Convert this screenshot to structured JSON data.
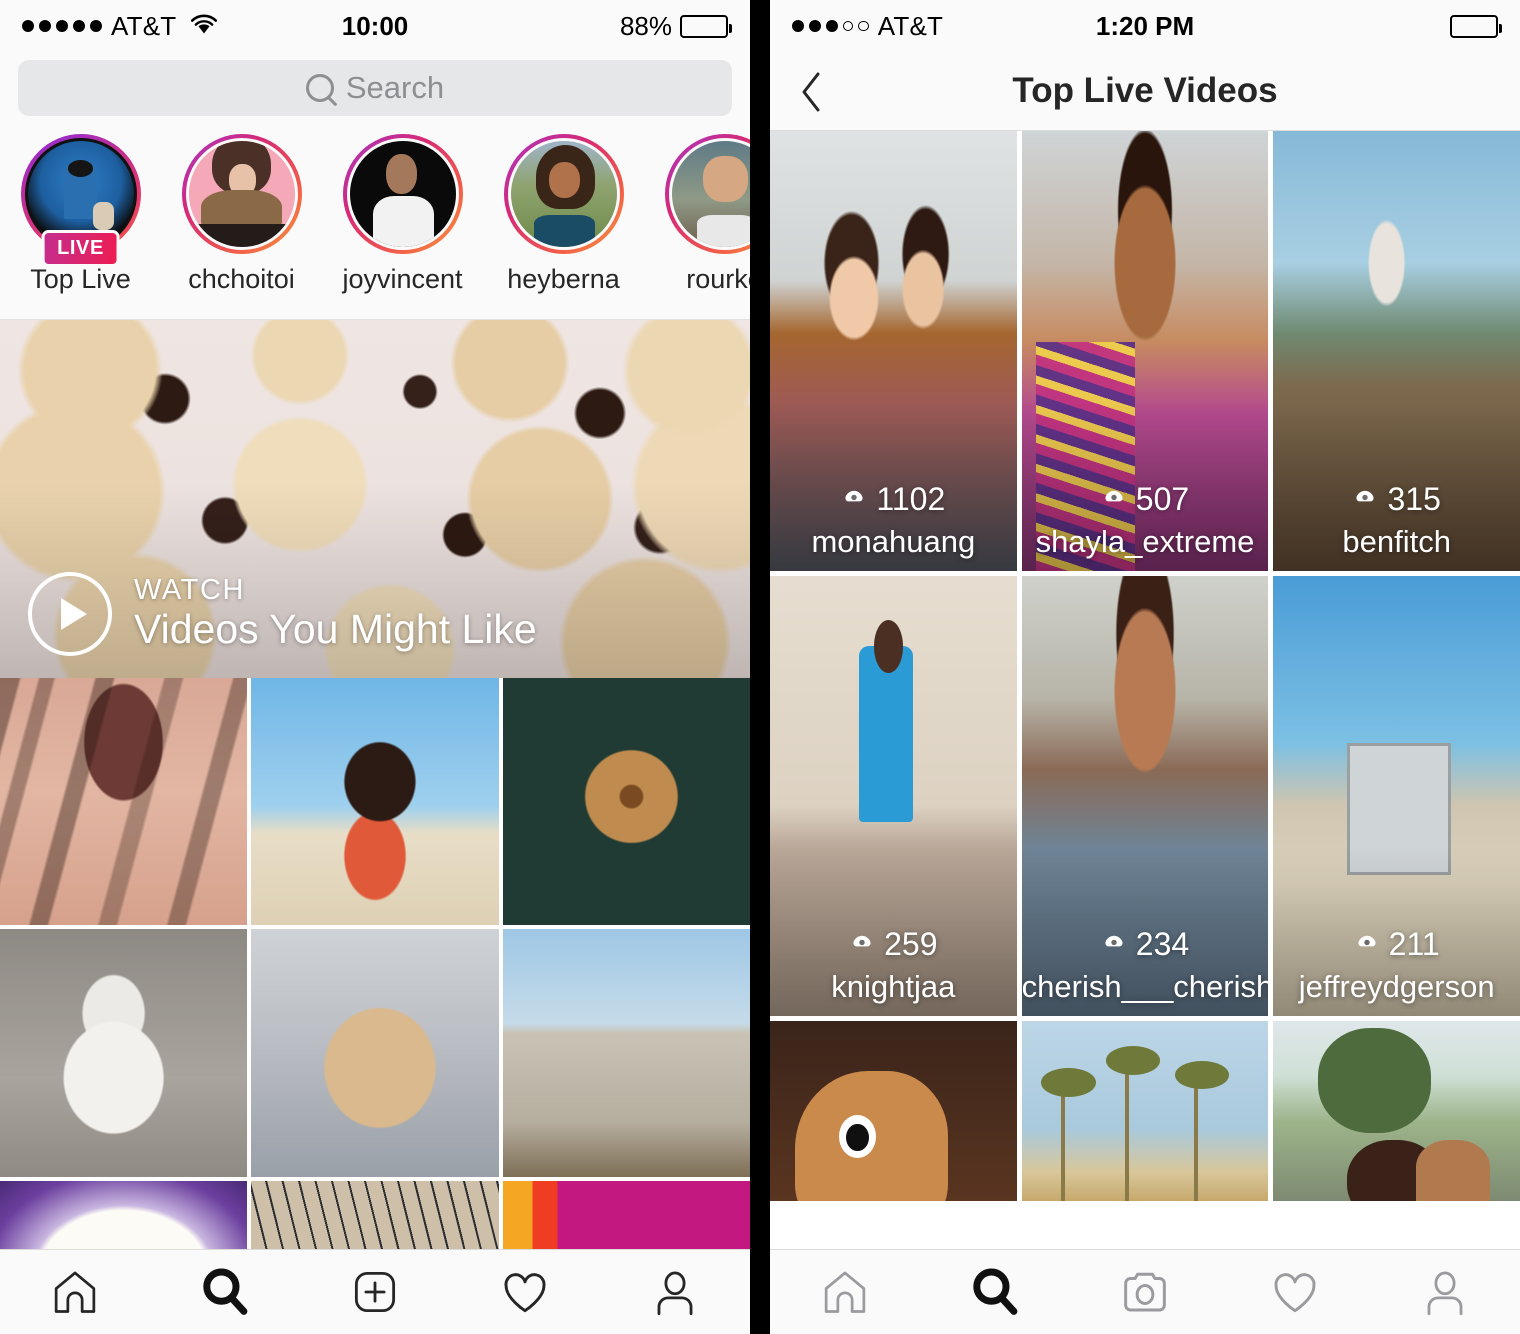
{
  "left": {
    "status": {
      "carrier": "AT&T",
      "time": "10:00",
      "battery": "88%",
      "signal_dots": 5,
      "signal_filled": 5,
      "wifi": true
    },
    "search": {
      "placeholder": "Search",
      "icon": "search-icon"
    },
    "stories": [
      {
        "username": "Top Live",
        "badge": "LIVE",
        "is_live": true
      },
      {
        "username": "chchoitoi",
        "badge": null,
        "is_live": false
      },
      {
        "username": "joyvincent",
        "badge": null,
        "is_live": false
      },
      {
        "username": "heyberna",
        "badge": null,
        "is_live": false
      },
      {
        "username": "rourke",
        "badge": null,
        "is_live": false
      }
    ],
    "banner": {
      "eyebrow": "WATCH",
      "title": "Videos You Might Like",
      "icon": "play-icon"
    },
    "grid_rows": [
      [
        "house-shadow-photo",
        "beach-girl-photo",
        "sprinkle-donut-photo"
      ],
      [
        "dog-on-sand-photo",
        "cat-on-bed-photo",
        "city-overlook-photo"
      ],
      [
        "airplane-window-photo",
        "glass-ceiling-photo",
        "color-gradient-photo"
      ]
    ],
    "tabbar": [
      {
        "name": "home-icon",
        "label": "Home",
        "active": false
      },
      {
        "name": "search-icon",
        "label": "Search",
        "active": true
      },
      {
        "name": "add-post-icon",
        "label": "New Post",
        "active": false
      },
      {
        "name": "heart-icon",
        "label": "Activity",
        "active": false
      },
      {
        "name": "profile-icon",
        "label": "Profile",
        "active": false
      }
    ]
  },
  "right": {
    "status": {
      "carrier": "AT&T",
      "time": "1:20 PM",
      "battery": "",
      "signal_dots": 5,
      "signal_filled": 3,
      "wifi": false
    },
    "nav": {
      "title": "Top Live Videos",
      "back_icon": "chevron-left-icon"
    },
    "live_rows": [
      [
        {
          "viewers": "1102",
          "username": "monahuang"
        },
        {
          "viewers": "507",
          "username": "shayla_extreme"
        },
        {
          "viewers": "315",
          "username": "benfitch"
        }
      ],
      [
        {
          "viewers": "259",
          "username": "knightjaa"
        },
        {
          "viewers": "234",
          "username": "cherish___cherish"
        },
        {
          "viewers": "211",
          "username": "jeffreydgerson"
        }
      ],
      [
        {
          "viewers": "",
          "username": ""
        },
        {
          "viewers": "",
          "username": ""
        },
        {
          "viewers": "",
          "username": ""
        }
      ]
    ],
    "tabbar": [
      {
        "name": "home-icon",
        "label": "Home",
        "active": false
      },
      {
        "name": "search-icon",
        "label": "Search",
        "active": true
      },
      {
        "name": "camera-icon",
        "label": "Camera",
        "active": false
      },
      {
        "name": "heart-icon",
        "label": "Activity",
        "active": false
      },
      {
        "name": "profile-icon",
        "label": "Profile",
        "active": false
      }
    ]
  },
  "colors": {
    "story_ring_start": "#a536c8",
    "story_ring_end": "#f79a3b",
    "live_badge": "#ed1d52",
    "bg": "#fafafa",
    "text": "#262626",
    "placeholder": "#8e8e93",
    "search_field": "#e6e7e9",
    "inactive_icon": "#9a9a9f"
  }
}
